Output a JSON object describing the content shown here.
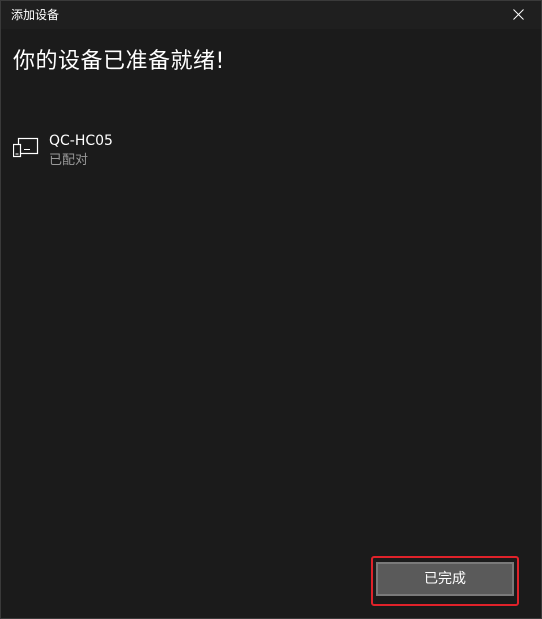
{
  "window": {
    "title": "添加设备"
  },
  "main": {
    "heading": "你的设备已准备就绪!"
  },
  "device": {
    "name": "QC-HC05",
    "status": "已配对",
    "icon": "device-icon"
  },
  "footer": {
    "done_label": "已完成",
    "highlight_color": "#e0222a"
  }
}
